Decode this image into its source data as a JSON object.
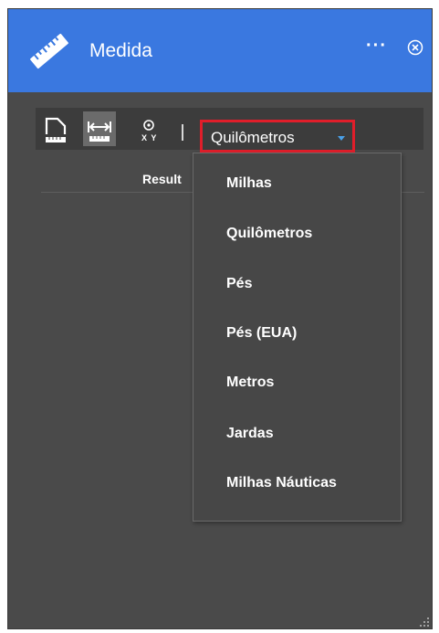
{
  "window": {
    "title": "Medida",
    "title_icon": "ruler-icon",
    "more_label": "···",
    "close_icon": "close-circle-icon",
    "accent_color": "#3a78e0"
  },
  "toolbar": {
    "tools": [
      {
        "name": "area-tool",
        "icon": "area-measure-icon",
        "active": false
      },
      {
        "name": "distance-tool",
        "icon": "distance-measure-icon",
        "active": true
      },
      {
        "name": "location-tool",
        "icon": "location-xy-icon",
        "active": false
      }
    ],
    "location_tool_label": "X Y",
    "unit_select": {
      "selected": "Quilômetros",
      "highlight_color": "#e01e2a"
    }
  },
  "results": {
    "label": "Result"
  },
  "unit_dropdown": {
    "options": [
      "Milhas",
      "Quilômetros",
      "Pés",
      "Pés (EUA)",
      "Metros",
      "Jardas",
      "Milhas Náuticas"
    ]
  }
}
